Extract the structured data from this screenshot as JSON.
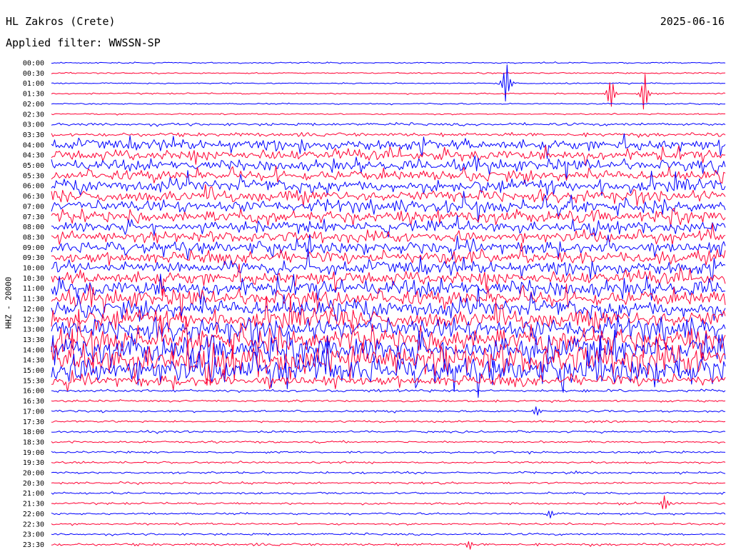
{
  "header": {
    "station": "HL Zakros (Crete)",
    "date": "2025-06-16",
    "filter": "Applied filter: WWSSN-SP"
  },
  "chart_data": {
    "type": "line",
    "title": "HL Zakros (Crete)",
    "ylabel": "HHZ - 20000",
    "colors": [
      "#0000ff",
      "#ff0033"
    ],
    "row_labels": [
      "00:00",
      "00:30",
      "01:00",
      "01:30",
      "02:00",
      "02:30",
      "03:00",
      "03:30",
      "04:00",
      "04:30",
      "05:00",
      "05:30",
      "06:00",
      "06:30",
      "07:00",
      "07:30",
      "08:00",
      "08:30",
      "09:00",
      "09:30",
      "10:00",
      "10:30",
      "11:00",
      "11:30",
      "12:00",
      "12:30",
      "13:00",
      "13:30",
      "14:00",
      "14:30",
      "15:00",
      "15:30",
      "16:00",
      "16:30",
      "17:00",
      "17:30",
      "18:00",
      "18:30",
      "19:00",
      "19:30",
      "20:00",
      "20:30",
      "21:00",
      "21:30",
      "22:00",
      "22:30",
      "23:00",
      "23:30"
    ],
    "noise_level": [
      1,
      1,
      1,
      1,
      1,
      1,
      2,
      3,
      8,
      8,
      8,
      8,
      9,
      9,
      9,
      9,
      8,
      8,
      9,
      9,
      10,
      10,
      12,
      12,
      13,
      14,
      16,
      18,
      20,
      22,
      20,
      8,
      2,
      1.5,
      1.5,
      1.5,
      1.5,
      1.5,
      1.5,
      1.5,
      1.5,
      1.5,
      1.5,
      1.5,
      1.5,
      1.5,
      1.5,
      2
    ],
    "events": [
      {
        "row": 2,
        "position": 0.675,
        "amplitude": 45
      },
      {
        "row": 3,
        "position": 0.83,
        "amplitude": 38
      },
      {
        "row": 3,
        "position": 0.88,
        "amplitude": 40
      },
      {
        "row": 34,
        "position": 0.72,
        "amplitude": 12
      },
      {
        "row": 43,
        "position": 0.91,
        "amplitude": 22
      },
      {
        "row": 44,
        "position": 0.74,
        "amplitude": 10
      },
      {
        "row": 47,
        "position": 0.62,
        "amplitude": 12
      }
    ]
  }
}
